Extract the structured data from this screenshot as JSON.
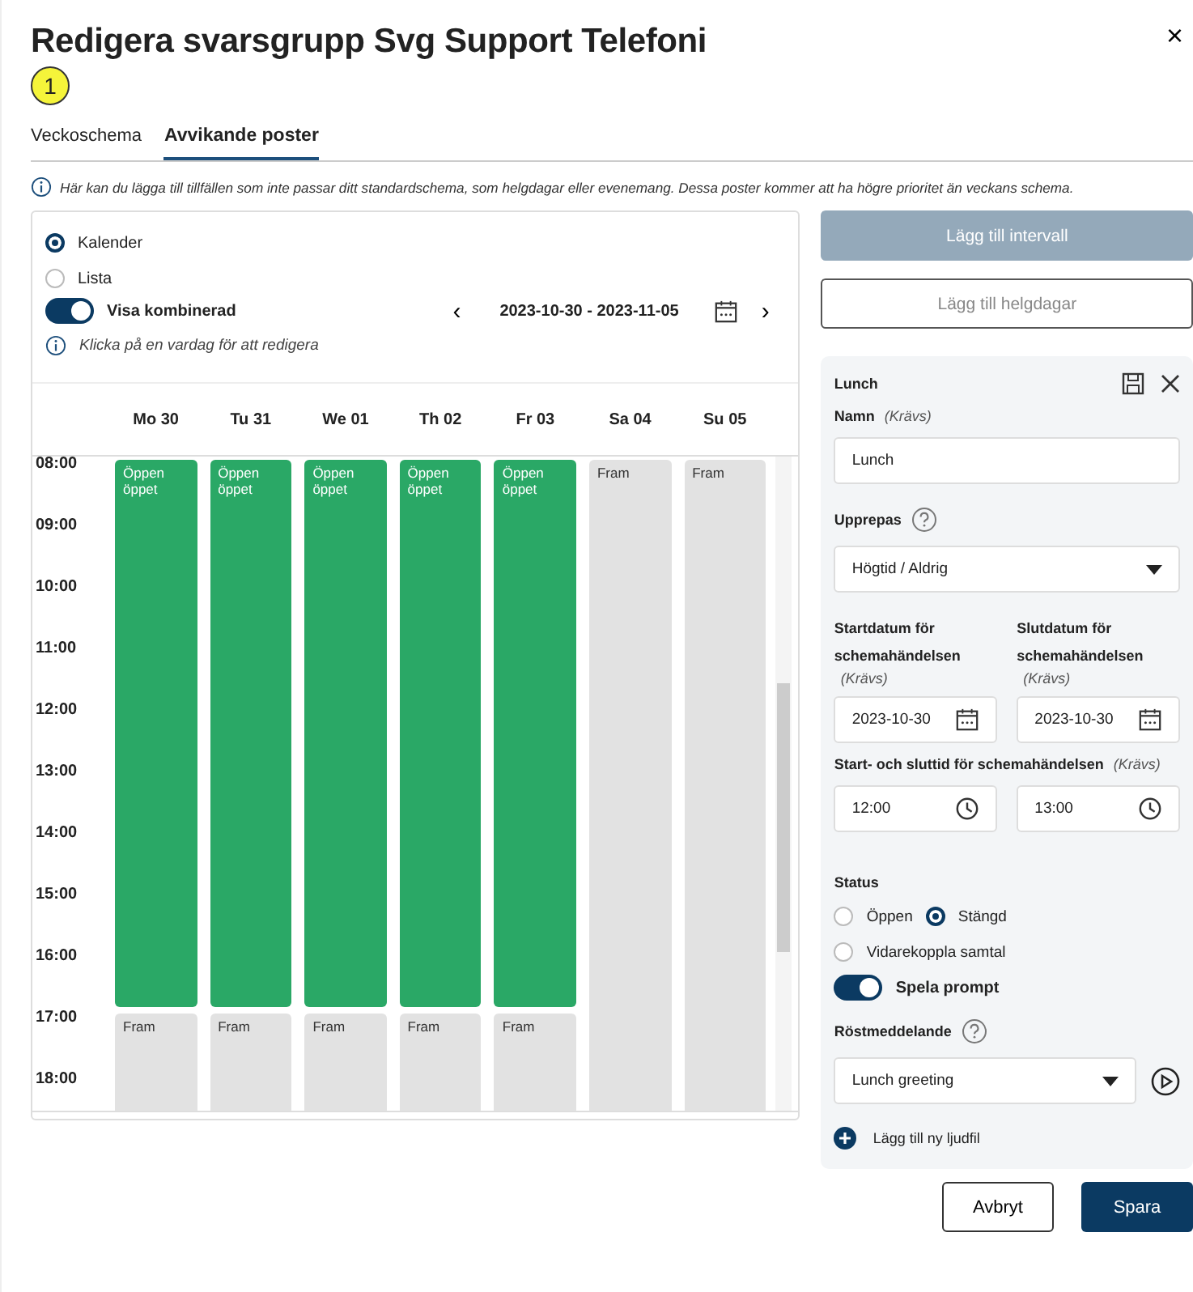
{
  "dialog": {
    "title": "Redigera svarsgrupp Svg Support Telefoni",
    "badge": "1",
    "close": "×"
  },
  "tabs": [
    {
      "label": "Veckoschema",
      "selected": false
    },
    {
      "label": "Avvikande poster",
      "selected": true
    }
  ],
  "info": "Här kan du lägga till tillfällen som inte passar ditt standardschema, som helgdagar eller evenemang. Dessa poster kommer att ha högre prioritet än veckans schema.",
  "calendar": {
    "views": [
      {
        "label": "Kalender",
        "selected": true
      },
      {
        "label": "Lista",
        "selected": false
      }
    ],
    "combined": {
      "label": "Visa kombinerad",
      "on": true
    },
    "range": "2023-10-30 - 2023-11-05",
    "prev": "‹",
    "next": "›",
    "hint": "Klicka på en vardag för att redigera",
    "hours": [
      "08:00",
      "09:00",
      "10:00",
      "11:00",
      "12:00",
      "13:00",
      "14:00",
      "15:00",
      "16:00",
      "17:00",
      "18:00"
    ],
    "days": [
      {
        "label": "Mo 30",
        "events": [
          {
            "kind": "open",
            "title": "Öppen",
            "subtitle": "öppet"
          },
          {
            "kind": "forward",
            "title": "Fram"
          }
        ]
      },
      {
        "label": "Tu 31",
        "events": [
          {
            "kind": "open",
            "title": "Öppen",
            "subtitle": "öppet"
          },
          {
            "kind": "forward",
            "title": "Fram"
          }
        ]
      },
      {
        "label": "We 01",
        "events": [
          {
            "kind": "open",
            "title": "Öppen",
            "subtitle": "öppet"
          },
          {
            "kind": "forward",
            "title": "Fram"
          }
        ]
      },
      {
        "label": "Th 02",
        "events": [
          {
            "kind": "open",
            "title": "Öppen",
            "subtitle": "öppet"
          },
          {
            "kind": "forward",
            "title": "Fram"
          }
        ]
      },
      {
        "label": "Fr 03",
        "events": [
          {
            "kind": "open",
            "title": "Öppen",
            "subtitle": "öppet"
          },
          {
            "kind": "forward",
            "title": "Fram"
          }
        ]
      },
      {
        "label": "Sa 04",
        "events": [
          {
            "kind": "forward",
            "title": "Fram"
          }
        ]
      },
      {
        "label": "Su 05",
        "events": [
          {
            "kind": "forward",
            "title": "Fram"
          }
        ]
      }
    ]
  },
  "actions": {
    "add_interval": {
      "label": "Lägg till intervall",
      "disabled": true
    },
    "add_holidays": "Lägg till helgdagar"
  },
  "editor": {
    "title": "Lunch",
    "name": {
      "label": "Namn",
      "required": "(Krävs)",
      "value": "Lunch"
    },
    "repeat": {
      "label": "Upprepas",
      "value": "Högtid / Aldrig"
    },
    "start_date": {
      "label": "Startdatum för schemahändelsen",
      "required": "(Krävs)",
      "value": "2023-10-30"
    },
    "end_date": {
      "label": "Slutdatum för schemahändelsen",
      "required": "(Krävs)",
      "value": "2023-10-30"
    },
    "time": {
      "label": "Start- och sluttid för schemahändelsen",
      "required": "(Krävs)",
      "start": "12:00",
      "end": "13:00"
    },
    "status": {
      "label": "Status",
      "options": [
        {
          "label": "Öppen",
          "selected": false
        },
        {
          "label": "Stängd",
          "selected": true
        },
        {
          "label": "Vidarekoppla samtal",
          "selected": false
        }
      ]
    },
    "prompt": {
      "label": "Spela prompt",
      "on": true
    },
    "voice": {
      "label": "Röstmeddelande",
      "value": "Lunch greeting"
    },
    "add_file": "Lägg till ny ljudfil"
  },
  "buttons": {
    "cancel": "Avbryt",
    "save": "Spara"
  }
}
